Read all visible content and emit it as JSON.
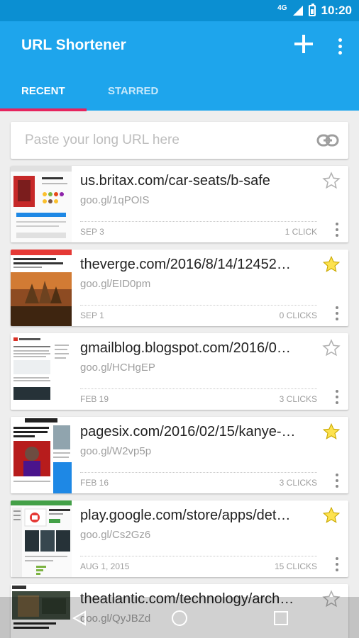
{
  "status_bar": {
    "network": "4G",
    "time": "10:20"
  },
  "app_bar": {
    "title": "URL Shortener",
    "add_icon": "plus-icon",
    "more_icon": "more-vert-icon"
  },
  "tabs": [
    {
      "label": "RECENT",
      "active": true
    },
    {
      "label": "STARRED",
      "active": false
    }
  ],
  "search": {
    "placeholder": "Paste your long URL here",
    "value": "",
    "icon": "link-icon"
  },
  "links": [
    {
      "url": "us.britax.com/car-seats/b-safe",
      "short": "goo.gl/1qPOIS",
      "date": "SEP 3",
      "clicks": "1 CLICK",
      "starred": false
    },
    {
      "url": "theverge.com/2016/8/14/12452…",
      "short": "goo.gl/EID0pm",
      "date": "SEP 1",
      "clicks": "0 CLICKS",
      "starred": true
    },
    {
      "url": "gmailblog.blogspot.com/2016/0…",
      "short": "goo.gl/HCHgEP",
      "date": "FEB 19",
      "clicks": "3 CLICKS",
      "starred": false
    },
    {
      "url": "pagesix.com/2016/02/15/kanye-…",
      "short": "goo.gl/W2vp5p",
      "date": "FEB 16",
      "clicks": "3 CLICKS",
      "starred": true
    },
    {
      "url": "play.google.com/store/apps/det…",
      "short": "goo.gl/Cs2Gz6",
      "date": "AUG 1, 2015",
      "clicks": "15 CLICKS",
      "starred": true
    },
    {
      "url": "theatlantic.com/technology/arch…",
      "short": "goo.gl/QyJBZd",
      "date": "",
      "clicks": "",
      "starred": false
    }
  ],
  "colors": {
    "status_bar": "#0b8fd2",
    "app_bar": "#1ea5ec",
    "tab_indicator": "#e6245e",
    "star_filled": "#fde24f",
    "background": "#eeeeee"
  },
  "nav_bar": {
    "back_icon": "back-triangle-icon",
    "home_icon": "home-circle-icon",
    "recents_icon": "recents-square-icon"
  }
}
